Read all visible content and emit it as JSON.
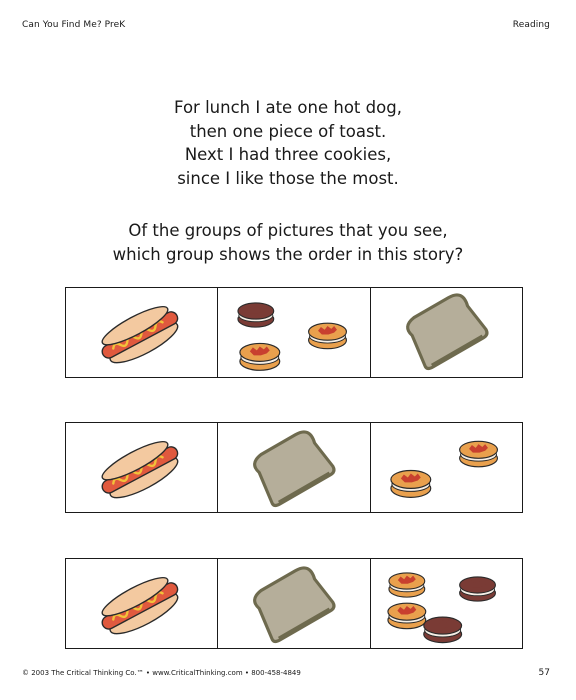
{
  "header": {
    "left": "Can You Find Me?  PreK",
    "right": "Reading"
  },
  "poem": [
    "For lunch I ate one hot dog,",
    "then one piece of toast.",
    "Next I had three cookies,",
    "since I like those the most."
  ],
  "question": [
    "Of the groups of pictures that you see,",
    "which group shows the order in this story?"
  ],
  "rows": [
    [
      "hotdog-icon",
      "cookies-icon",
      "toast-icon"
    ],
    [
      "hotdog-icon",
      "toast-icon",
      "cookies-icon"
    ],
    [
      "hotdog-icon",
      "toast-icon",
      "cookies-icon"
    ]
  ],
  "colors": {
    "bun": "#F3C9A0",
    "sausage": "#E0593E",
    "mustard": "#F2C23A",
    "toast": "#B5AE9A",
    "toast_crust": "#6E6A4E",
    "cookie_orange": "#E9A04D",
    "cookie_filling": "#C8402F",
    "sandwich_dark": "#7A3B35"
  },
  "footer": {
    "left": "© 2003 The Critical Thinking Co.™ • www.CriticalThinking.com • 800-458-4849",
    "page": "57"
  }
}
